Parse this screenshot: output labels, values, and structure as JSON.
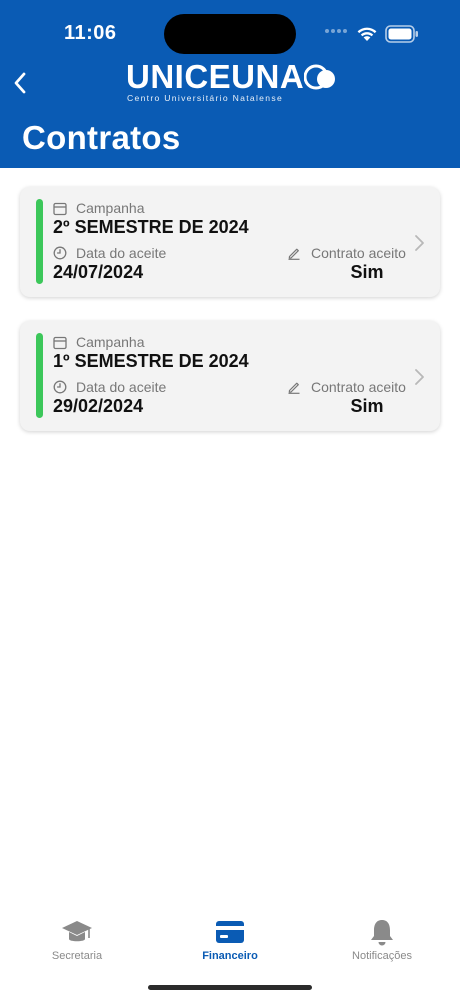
{
  "status": {
    "time": "11:06"
  },
  "header": {
    "logo_text": "UNICEUNA",
    "logo_subtitle": "Centro Universitário Natalense",
    "title": "Contratos"
  },
  "contracts": [
    {
      "campaign_label": "Campanha",
      "campaign_value": "2º SEMESTRE DE 2024",
      "date_label": "Data do aceite",
      "date_value": "24/07/2024",
      "accepted_label": "Contrato aceito",
      "accepted_value": "Sim"
    },
    {
      "campaign_label": "Campanha",
      "campaign_value": "1º SEMESTRE DE 2024",
      "date_label": "Data do aceite",
      "date_value": "29/02/2024",
      "accepted_label": "Contrato aceito",
      "accepted_value": "Sim"
    }
  ],
  "tabbar": {
    "items": [
      {
        "label": "Secretaria",
        "icon": "graduation-cap-icon",
        "active": false
      },
      {
        "label": "Financeiro",
        "icon": "credit-card-icon",
        "active": true
      },
      {
        "label": "Notificações",
        "icon": "bell-icon",
        "active": false
      }
    ]
  },
  "colors": {
    "brand": "#0a5bb4",
    "status_accepted": "#3cc75a",
    "tab_inactive": "#8a8a8a"
  }
}
